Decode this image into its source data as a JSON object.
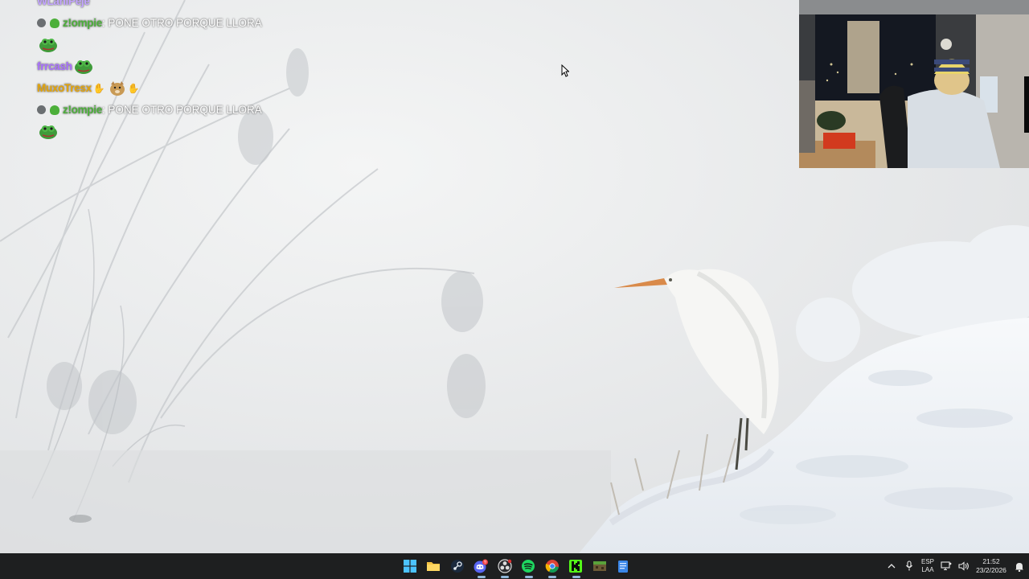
{
  "chat": {
    "messages": [
      {
        "user": "WLaniPeje",
        "text": "",
        "user_color": "#c2a3ff"
      },
      {
        "user": "z!ompie",
        "text": ": PONE OTRO PORQUE LLORA",
        "user_color": "#4caf3a"
      },
      {
        "user": "",
        "text": "",
        "emote": "frog-emote"
      },
      {
        "user": "frrcash",
        "text": "",
        "user_color": "#a970ff",
        "emote": "frog-emote"
      },
      {
        "user": "MuxoTresx",
        "text": "",
        "user_color": "#e5a50a",
        "emote": "doge-emote"
      },
      {
        "user": "z!ompie",
        "text": ": PONE OTRO PORQUE LLORA",
        "user_color": "#4caf3a"
      },
      {
        "user": "",
        "text": "",
        "emote": "frog-emote"
      }
    ]
  },
  "taskbar": {
    "apps": [
      {
        "name": "start-button",
        "icon": "windows-logo-icon"
      },
      {
        "name": "file-explorer",
        "icon": "folder-icon"
      },
      {
        "name": "steam",
        "icon": "steam-icon"
      },
      {
        "name": "discord",
        "icon": "discord-icon",
        "badge": "9"
      },
      {
        "name": "obs",
        "icon": "obs-icon"
      },
      {
        "name": "spotify",
        "icon": "spotify-icon"
      },
      {
        "name": "chrome",
        "icon": "chrome-icon"
      },
      {
        "name": "kick",
        "icon": "kick-icon"
      },
      {
        "name": "minecraft",
        "icon": "minecraft-icon"
      },
      {
        "name": "notepad",
        "icon": "notepad-icon"
      }
    ],
    "tray": {
      "lang_line1": "ESP",
      "lang_line2": "LAA",
      "time": "21:52",
      "date": "23/2/2026"
    }
  },
  "colors": {
    "taskbar_bg": "#1e1f20",
    "accent": "#8fb6d8"
  }
}
